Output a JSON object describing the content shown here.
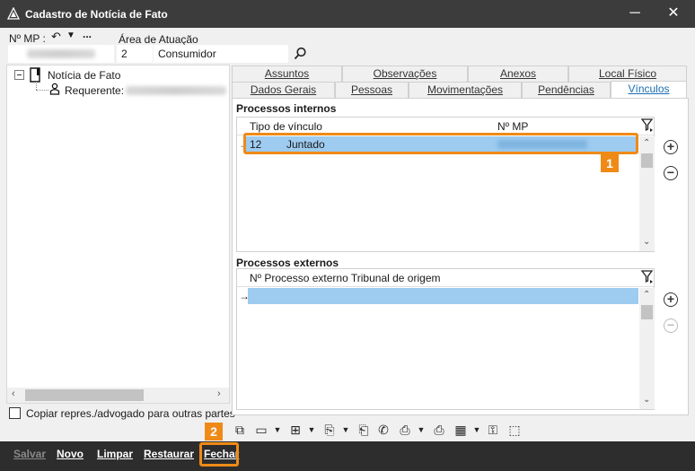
{
  "window": {
    "title": "Cadastro de Notícia de Fato",
    "minimize_glyph": "─",
    "close_glyph": "✕"
  },
  "header": {
    "mp_label": "Nº MP :",
    "area_label": "Área de Atuação",
    "area_code": "2",
    "area_name": "Consumidor",
    "more_glyph": "..."
  },
  "tree": {
    "root_label": "Notícia de Fato",
    "child_label": "Requerente:"
  },
  "copy_checkbox_label": "Copiar repres./advogado para outras partes",
  "tabs_row1": [
    "Assuntos",
    "Observações",
    "Anexos",
    "Local Físico"
  ],
  "tabs_row2": [
    "Dados Gerais",
    "Pessoas",
    "Movimentações",
    "Pendências",
    "Vínculos"
  ],
  "internos": {
    "title": "Processos internos",
    "col_tipo": "Tipo de vínculo",
    "col_mp": "Nº MP",
    "rows": [
      {
        "arrow": "→",
        "code": "12",
        "tipo": "Juntado"
      }
    ]
  },
  "externos": {
    "title": "Processos externos",
    "col_processo": "Nº Processo externo Tribunal de origem",
    "rows": [
      {
        "arrow": "→"
      }
    ]
  },
  "annotations": {
    "badge1": "1",
    "badge2": "2"
  },
  "footer": {
    "salvar": "Salvar",
    "novo": "Novo",
    "limpar": "Limpar",
    "restaurar": "Restaurar",
    "fechar": "Fechar"
  },
  "colors": {
    "titlebar": "#3c3c3c",
    "selection": "#9ecbf0",
    "accent": "#ef8a17",
    "active_tab_text": "#1a6fb5",
    "footer": "#2d2d2d"
  }
}
